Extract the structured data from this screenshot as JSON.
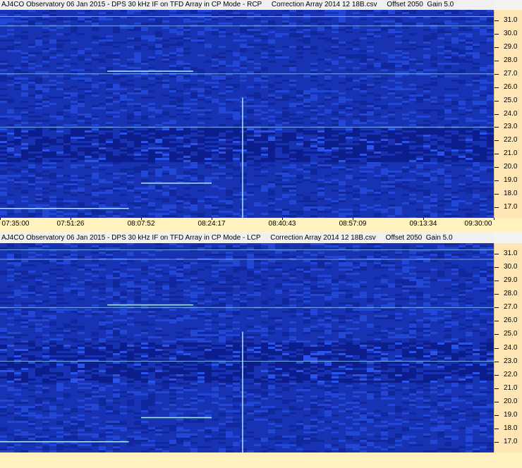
{
  "chart_data": [
    {
      "type": "heatmap",
      "title": "AJ4CO Observatory 06 Jan 2015 - DPS 30 kHz IF on TFD Array in CP Mode - RCP     Correction Array 2014 12 18B.csv     Offset 2050  Gain 5.0",
      "ylabel": "",
      "xlabel": "",
      "yticks": [
        "31.0",
        "30.0",
        "29.0",
        "28.0",
        "27.0",
        "26.0",
        "25.0",
        "24.0",
        "23.0",
        "22.0",
        "21.0",
        "20.0",
        "19.0",
        "18.0",
        "17.0"
      ],
      "ylim": [
        16.2,
        31.8
      ],
      "xticks": [
        "07:35:00",
        "07:51:26",
        "08:07:52",
        "08:24:17",
        "08:40:43",
        "08:57:09",
        "09:13:34",
        "09:30:00"
      ],
      "xlim": [
        "07:35:00",
        "09:30:00"
      ],
      "colormap": [
        "#0a1880",
        "#1733b4",
        "#3060ff",
        "#8cc8ff"
      ],
      "features": {
        "horizontal_lines_mhz": [
          31.3,
          30.6,
          27.0,
          23.0
        ],
        "dark_band_mhz": [
          20.5,
          23.0
        ],
        "vertical_streak_time": "08:31:30",
        "carrier_lines": [
          {
            "mhz": 18.8,
            "from": "08:07:52",
            "to": "08:24:17"
          },
          {
            "mhz": 27.2,
            "from": "08:00:00",
            "to": "08:20:00"
          },
          {
            "mhz": 16.9,
            "from": "07:35:00",
            "to": "08:05:00"
          }
        ]
      }
    },
    {
      "type": "heatmap",
      "title": "AJ4CO Observatory 06 Jan 2015 - DPS 30 kHz IF on TFD Array in CP Mode - LCP     Correction Array 2014 12 18B.csv     Offset 2050  Gain 5.0",
      "ylabel": "",
      "xlabel": "",
      "yticks": [
        "31.0",
        "30.0",
        "29.0",
        "28.0",
        "27.0",
        "26.0",
        "25.0",
        "24.0",
        "23.0",
        "22.0",
        "21.0",
        "20.0",
        "19.0",
        "18.0",
        "17.0"
      ],
      "ylim": [
        16.2,
        31.8
      ],
      "xticks": [],
      "xlim": [
        "07:35:00",
        "09:30:00"
      ],
      "colormap": [
        "#0a1880",
        "#1733b4",
        "#3060ff",
        "#8cc8ff"
      ],
      "features": {
        "horizontal_lines_mhz": [
          31.3,
          30.6,
          27.0,
          23.0
        ],
        "dark_band_mhz": [
          21.5,
          24.5
        ],
        "vertical_streak_time": "08:31:30",
        "carrier_lines": [
          {
            "mhz": 18.8,
            "from": "08:07:52",
            "to": "08:24:17"
          },
          {
            "mhz": 27.2,
            "from": "08:00:00",
            "to": "08:20:00"
          },
          {
            "mhz": 17.0,
            "from": "07:35:00",
            "to": "08:05:00"
          }
        ]
      }
    }
  ]
}
